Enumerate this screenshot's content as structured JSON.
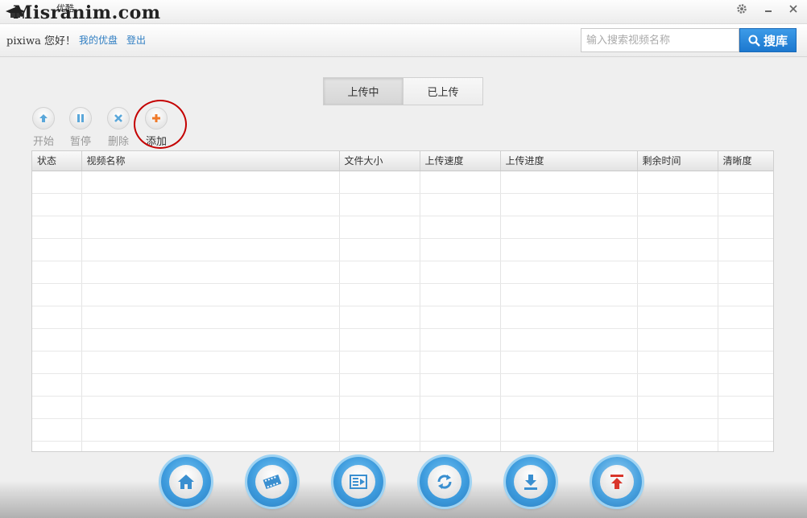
{
  "titlebar": {
    "brand_cn": "优酷",
    "watermark": "Misranim.com"
  },
  "userbar": {
    "greeting": "pixiwa 您好！",
    "my_disk": "我的优盘",
    "logout": "登出",
    "search_placeholder": "输入搜索视频名称",
    "search_button": "搜库"
  },
  "tabs": [
    {
      "label": "上传中",
      "active": true
    },
    {
      "label": "已上传",
      "active": false
    }
  ],
  "toolbar": {
    "start": "开始",
    "pause": "暂停",
    "delete": "删除",
    "add": "添加"
  },
  "table": {
    "columns": [
      "状态",
      "视频名称",
      "文件大小",
      "上传速度",
      "上传进度",
      "剩余时间",
      "清晰度"
    ]
  },
  "colors": {
    "accent": "#1c78cf",
    "link": "#2e7dc2",
    "highlight": "#c40000",
    "upload_red": "#d9362b"
  },
  "dock": [
    "home-icon",
    "film-icon",
    "playlist-icon",
    "refresh-icon",
    "download-icon",
    "upload-icon"
  ]
}
